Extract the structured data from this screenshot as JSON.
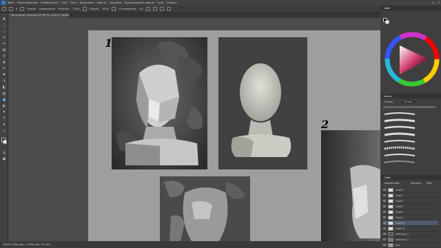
{
  "app": {
    "menu": [
      "Файл",
      "Редактирование",
      "Изображение",
      "Слои",
      "Текст",
      "Выделение",
      "Фильтр",
      "Просмотр",
      "Подключаемые модули",
      "Окно",
      "Справка"
    ]
  },
  "options": {
    "brush_size": "8",
    "mode_label": "Режим:",
    "mode_value": "Нормальный",
    "opacity_label": "Непрозр.:",
    "opacity_value": "100%",
    "flow_label": "Нажим:",
    "flow_value": "100%",
    "smoothing_label": "Сглаживание:",
    "smoothing_value": "0%"
  },
  "document": {
    "tab_title": "Обсуждение_Конкурсы @ 16,7% (Слой 15, RGB/8*) *"
  },
  "status": {
    "text": "16,67%  3840 пикс. x 2160 пикс. (72 ppi)"
  },
  "canvas": {
    "label_1": "1",
    "label_2": "2"
  },
  "panels": {
    "color_tabs": [
      "Цвет",
      "Образцы",
      "Градиенты",
      "Узоры"
    ],
    "brush_tabs": [
      "Кисти"
    ],
    "brush_size_label": "Размер:",
    "brush_size_value": "30 пикс.",
    "layers_tabs": [
      "Слои",
      "Каналы",
      "Контуры"
    ],
    "blend_mode": "Нормальный",
    "layer_opacity_label": "Непрозр.:",
    "layer_opacity_value": "100%",
    "layers": [
      "Слой 8",
      "Слой 7",
      "Слой 6",
      "Слой 5",
      "Слой 4",
      "Слой 3",
      "Слой 15",
      "Слой 10",
      "reference_1",
      "reference_2",
      "Фон"
    ]
  },
  "colors": {
    "accent": "#2b7fd4",
    "foreground": "#111111",
    "background": "#eeeeee"
  }
}
